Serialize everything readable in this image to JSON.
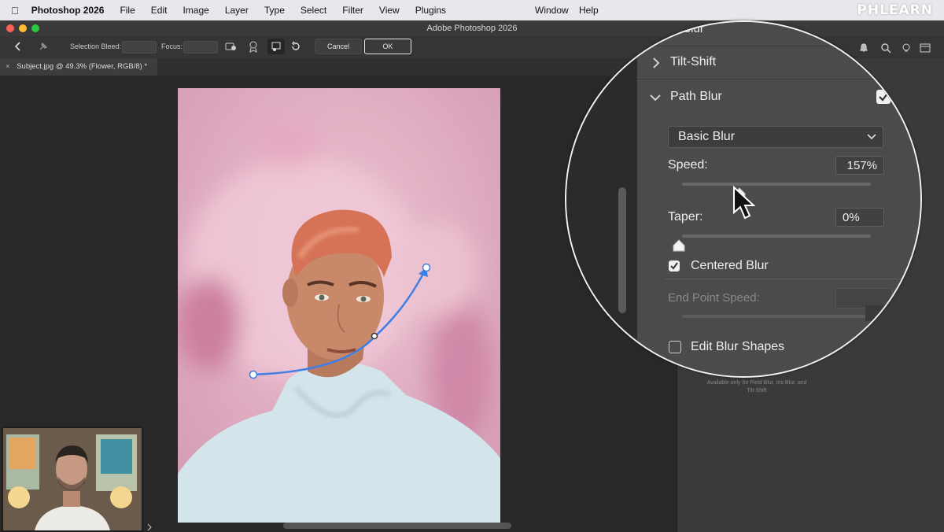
{
  "menubar": {
    "app_name": "Photoshop 2026",
    "items": [
      "File",
      "Edit",
      "Image",
      "Layer",
      "Type",
      "Select",
      "Filter",
      "View",
      "Plugins"
    ],
    "right_items": [
      "Window",
      "Help"
    ],
    "brand": "PHLEARN"
  },
  "window": {
    "title": "Adobe Photoshop 2026"
  },
  "options_bar": {
    "selection_bleed_label": "Selection Bleed:",
    "focus_label": "Focus:",
    "cancel_label": "Cancel",
    "ok_label": "OK"
  },
  "document_tab": {
    "close_glyph": "×",
    "title": "Subject.jpg @ 49.3% (Flower, RGB/8) *"
  },
  "blur_panel": {
    "iris_blur_label": "Iris Blur",
    "tilt_shift_label": "Tilt-Shift",
    "path_blur_label": "Path Blur",
    "path_blur_enabled": true,
    "blur_type_selected": "Basic Blur",
    "speed_label": "Speed:",
    "speed_value": "157%",
    "taper_label": "Taper:",
    "taper_value": "0%",
    "centered_blur_label": "Centered Blur",
    "centered_blur_checked": true,
    "end_point_speed_label": "End Point Speed:",
    "edit_blur_shapes_label": "Edit Blur Shapes",
    "edit_blur_shapes_checked": false,
    "note": "Available only for Field Blur, Iris Blur, and Tilt-Shift"
  },
  "colors": {
    "path_blue": "#3d7fe6",
    "traffic_red": "#fe5f57",
    "traffic_yellow": "#febc2e",
    "traffic_green": "#28c840"
  },
  "icons": [
    "apple-icon",
    "back-arrow-icon",
    "pin-icon",
    "save-mask-icon",
    "high-quality-icon",
    "remove-pin-icon",
    "reset-icon",
    "bell-icon",
    "search-icon",
    "lightbulb-icon",
    "layout-icon",
    "chevron-right-icon",
    "chevron-down-icon",
    "checkmark-icon",
    "mouse-cursor-icon"
  ]
}
